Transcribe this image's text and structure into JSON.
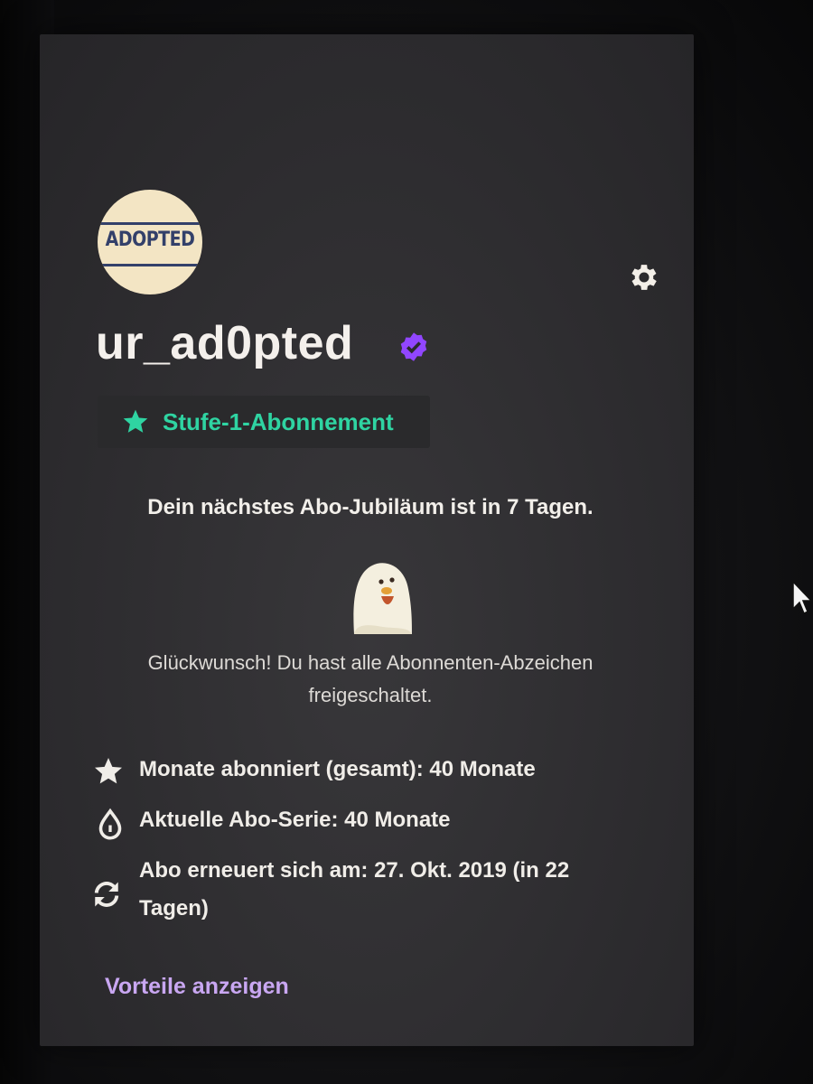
{
  "profile": {
    "avatar_text": "ADOPTED",
    "username": "ur_ad0pted"
  },
  "subscription": {
    "tier_label": "Stufe-1-Abonnement",
    "anniversary_prefix": "Dein nächstes Abo-Jubiläum ist in ",
    "anniversary_days": "7 Tagen",
    "anniversary_suffix": ".",
    "congrats_line1": "Glückwunsch! Du hast alle Abonnenten-Abzeichen",
    "congrats_line2": "freigeschaltet."
  },
  "stats": {
    "total_months": "Monate abonniert (gesamt): 40 Monate",
    "current_streak": "Aktuelle Abo-Serie: 40 Monate",
    "renewal_line1": "Abo erneuert sich am: 27. Okt. 2019 (in 22",
    "renewal_line2": "Tagen)"
  },
  "actions": {
    "benefits_link": "Vorteile anzeigen"
  },
  "icons": {
    "settings": "gear-icon",
    "verified": "verified-badge-icon",
    "tier": "star-icon",
    "months": "star-icon",
    "streak": "drop-icon",
    "renewal": "refresh-icon"
  },
  "colors": {
    "accent_green": "#2fd4a2",
    "verified_purple": "#9146ff",
    "link_purple": "#c9a7f2",
    "card_bg": "#2e2d30"
  }
}
